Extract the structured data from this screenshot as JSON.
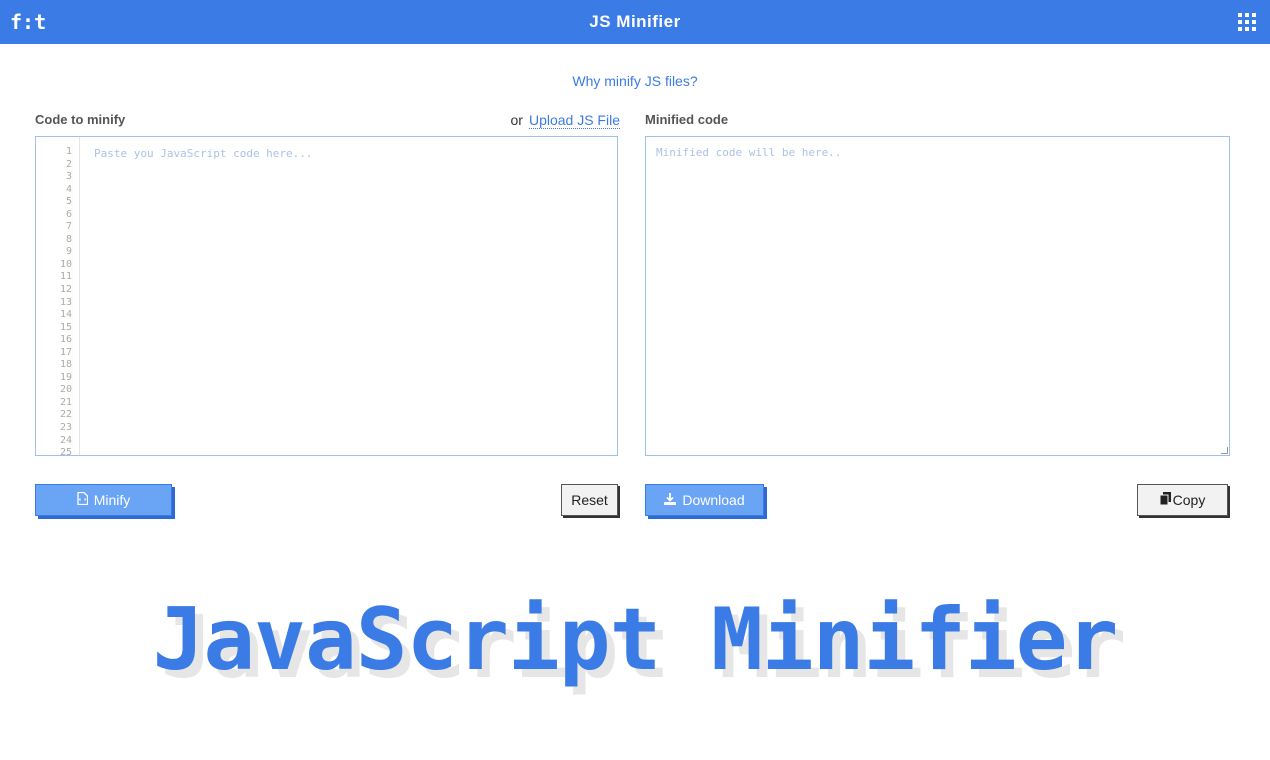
{
  "header": {
    "logo": "f:t",
    "title": "JS Minifier"
  },
  "links": {
    "why": "Why minify JS files?"
  },
  "input_panel": {
    "label": "Code to minify",
    "upload_prefix": "or",
    "upload_link": "Upload JS File",
    "placeholder": "Paste you JavaScript code here...",
    "line_numbers": [
      "1",
      "2",
      "3",
      "4",
      "5",
      "6",
      "7",
      "8",
      "9",
      "10",
      "11",
      "12",
      "13",
      "14",
      "15",
      "16",
      "17",
      "18",
      "19",
      "20",
      "21",
      "22",
      "23",
      "24",
      "25"
    ]
  },
  "output_panel": {
    "label": "Minified code",
    "placeholder": "Minified code will be here.."
  },
  "buttons": {
    "minify": "Minify",
    "reset": "Reset",
    "download": "Download",
    "copy": "Copy"
  },
  "hero": {
    "title": "JavaScript Minifier"
  },
  "colors": {
    "accent": "#3b7be6",
    "button_blue": "#6aa4f5"
  }
}
